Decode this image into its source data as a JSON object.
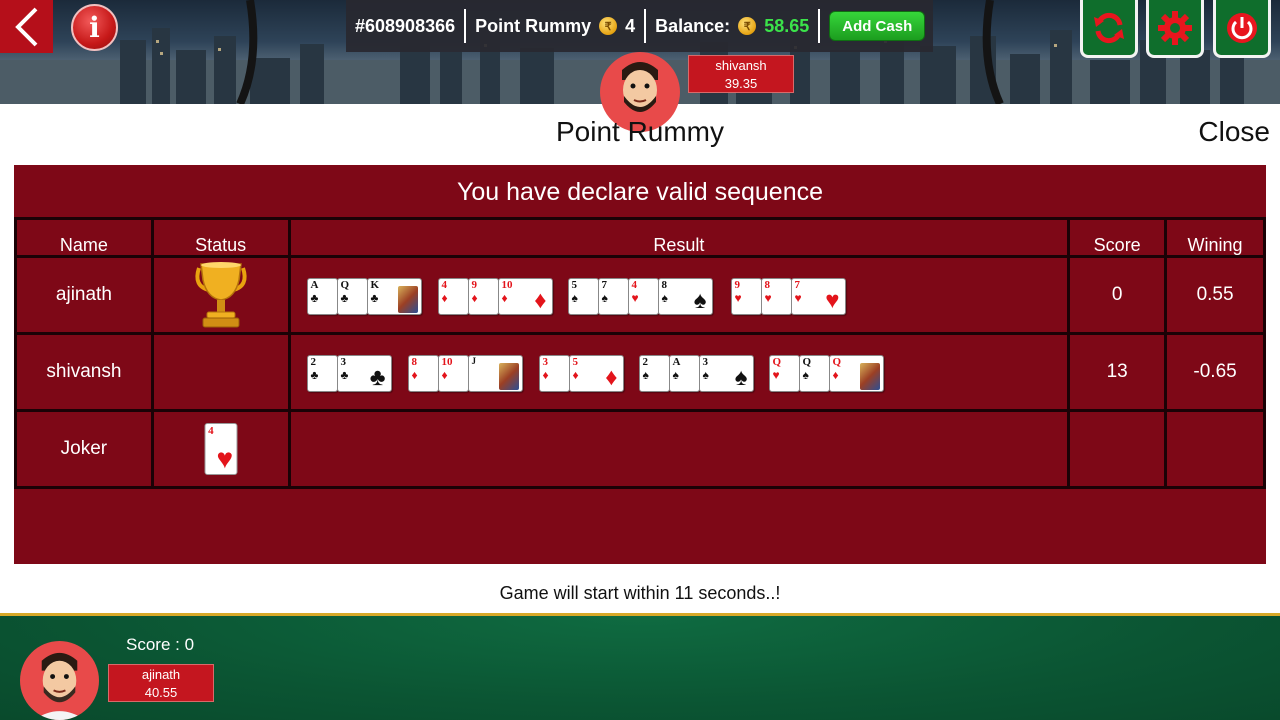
{
  "header": {
    "table_id": "#608908366",
    "game_type": "Point Rummy",
    "points": "4",
    "balance_label": "Balance:",
    "balance_value": "58.65",
    "add_cash_label": "Add Cash",
    "coin_symbol": "₹"
  },
  "opponent": {
    "name": "shivansh",
    "amount": "39.35"
  },
  "panel": {
    "title": "Point Rummy",
    "close_label": "Close",
    "message": "You have declare valid sequence",
    "columns": [
      "Name",
      "Status",
      "Result",
      "Score",
      "Wining"
    ],
    "rows": [
      {
        "name": "ajinath",
        "status_icon": "trophy-icon",
        "score": "0",
        "wining": "0.55"
      },
      {
        "name": "shivansh",
        "status_icon": "",
        "score": "13",
        "wining": "-0.65"
      },
      {
        "name": "Joker",
        "joker_rank": "4",
        "joker_suit": "♥"
      }
    ],
    "countdown": "Game will start within 11 seconds..!"
  },
  "player": {
    "score_label": "Score : 0",
    "name": "ajinath",
    "amount": "40.55"
  },
  "hands": {
    "ajinath": [
      [
        {
          "r": "A",
          "s": "♣"
        },
        {
          "r": "Q",
          "s": "♣"
        },
        {
          "r": "K",
          "s": "♣"
        }
      ],
      [
        {
          "r": "4",
          "s": "♦"
        },
        {
          "r": "9",
          "s": "♦"
        },
        {
          "r": "10",
          "s": "♦"
        }
      ],
      [
        {
          "r": "5",
          "s": "♠"
        },
        {
          "r": "7",
          "s": "♠"
        },
        {
          "r": "4",
          "s": "♥"
        },
        {
          "r": "8",
          "s": "♠"
        }
      ],
      [
        {
          "r": "9",
          "s": "♥"
        },
        {
          "r": "8",
          "s": "♥"
        },
        {
          "r": "7",
          "s": "♥"
        }
      ]
    ],
    "shivansh": [
      [
        {
          "r": "2",
          "s": "♣"
        },
        {
          "r": "3",
          "s": "♣"
        }
      ],
      [
        {
          "r": "8",
          "s": "♦"
        },
        {
          "r": "10",
          "s": "♦"
        },
        {
          "r": "JOKER",
          "s": ""
        }
      ],
      [
        {
          "r": "3",
          "s": "♦"
        },
        {
          "r": "5",
          "s": "♦"
        }
      ],
      [
        {
          "r": "2",
          "s": "♠"
        },
        {
          "r": "A",
          "s": "♠"
        },
        {
          "r": "3",
          "s": "♠"
        }
      ],
      [
        {
          "r": "Q",
          "s": "♥"
        },
        {
          "r": "Q",
          "s": "♠"
        },
        {
          "r": "Q",
          "s": "♦"
        }
      ]
    ]
  },
  "colors": {
    "panel_red": "#7e0817",
    "felt_green": "#0b5533",
    "balance_green": "#3be34a",
    "button_red": "#b50f1a"
  }
}
